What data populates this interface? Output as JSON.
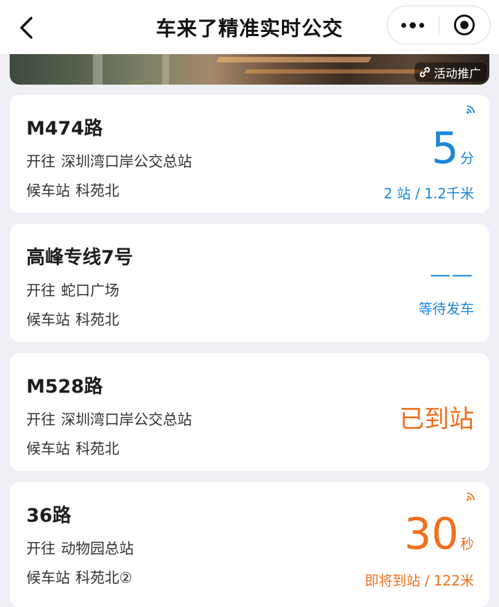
{
  "navbar": {
    "title": "车来了精准实时公交"
  },
  "banner": {
    "promo_label": "活动推广"
  },
  "cards": [
    {
      "route": "M474路",
      "direction_label": "开往",
      "direction": "深圳湾口岸公交总站",
      "stop_label": "候车站",
      "stop": "科苑北",
      "eta_value": "5",
      "eta_unit": "分",
      "distance": "2 站 / 1.2千米"
    },
    {
      "route": "高峰专线7号",
      "direction_label": "开往",
      "direction": "蛇口广场",
      "stop_label": "候车站",
      "stop": "科苑北",
      "eta_value": "——",
      "status": "等待发车"
    },
    {
      "route": "M528路",
      "direction_label": "开往",
      "direction": "深圳湾口岸公交总站",
      "stop_label": "候车站",
      "stop": "科苑北",
      "status": "已到站"
    },
    {
      "route": "36路",
      "direction_label": "开往",
      "direction": "动物园总站",
      "stop_label": "候车站",
      "stop": "科苑北②",
      "eta_value": "30",
      "eta_unit": "秒",
      "distance": "即将到站 / 122米"
    }
  ],
  "colors": {
    "blue": "#1a86d8",
    "orange": "#f0701e",
    "background": "#eef0f5"
  }
}
